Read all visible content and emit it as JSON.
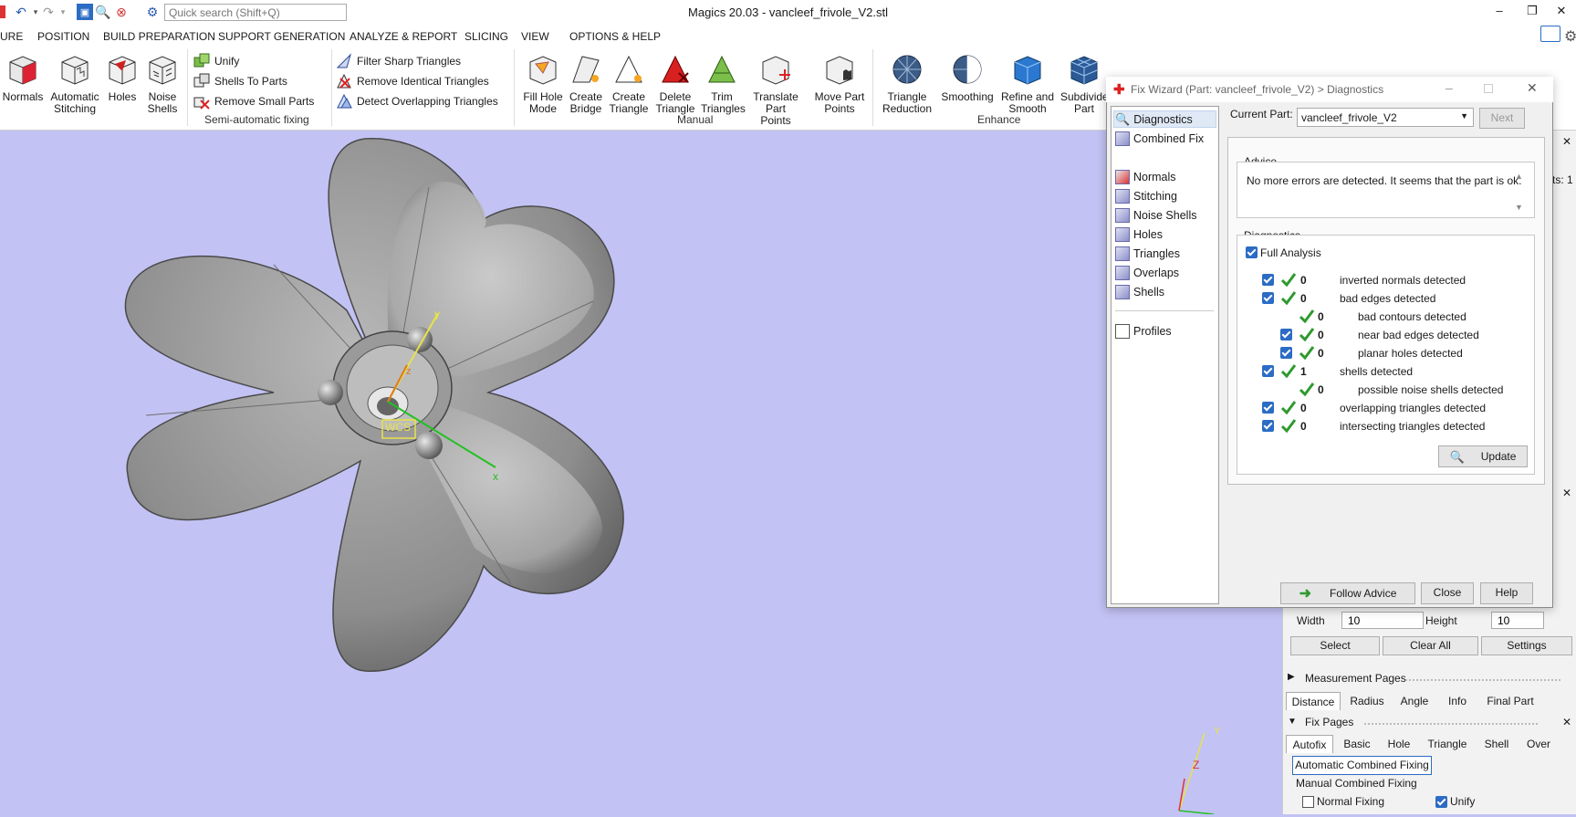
{
  "window": {
    "title": "Magics 20.03 - vancleef_frivole_V2.stl",
    "search_placeholder": "Quick search (Shift+Q)"
  },
  "menu": [
    "URE",
    "POSITION",
    "BUILD PREPARATION",
    "SUPPORT GENERATION",
    "ANALYZE & REPORT",
    "SLICING",
    "VIEW",
    "OPTIONS & HELP"
  ],
  "ribbon": {
    "normals": "Normals",
    "auto_stitch_1": "Automatic",
    "auto_stitch_2": "Stitching",
    "holes": "Holes",
    "noise_1": "Noise",
    "noise_2": "Shells",
    "unify": "Unify",
    "shells_to_parts": "Shells To Parts",
    "remove_small": "Remove Small Parts",
    "filter_sharp": "Filter Sharp Triangles",
    "remove_identical": "Remove Identical Triangles",
    "detect_overlap": "Detect Overlapping Triangles",
    "semi_auto_group": "Semi-automatic fixing",
    "fill_hole_1": "Fill Hole",
    "fill_hole_2": "Mode",
    "create_bridge_1": "Create",
    "create_bridge_2": "Bridge",
    "create_tri_1": "Create",
    "create_tri_2": "Triangle",
    "delete_tri_1": "Delete",
    "delete_tri_2": "Triangle",
    "trim_1": "Trim",
    "trim_2": "Triangles",
    "translate_1": "Translate",
    "translate_2": "Part Points",
    "move_1": "Move Part",
    "move_2": "Points",
    "manual_group": "Manual",
    "tri_red_1": "Triangle",
    "tri_red_2": "Reduction",
    "smoothing": "Smoothing",
    "refine_1": "Refine and",
    "refine_2": "Smooth",
    "subdiv_1": "Subdivide",
    "subdiv_2": "Part",
    "enhance_group": "Enhance"
  },
  "viewport": {
    "axis_x": "x",
    "axis_y": "y",
    "axis_z": "z",
    "wcs": "WCS",
    "mini_z": "Z",
    "mini_y": "Y"
  },
  "dialog": {
    "title": "Fix Wizard (Part: vancleef_frivole_V2) > Diagnostics",
    "nav": [
      "Diagnostics",
      "Combined Fix",
      "Normals",
      "Stitching",
      "Noise Shells",
      "Holes",
      "Triangles",
      "Overlaps",
      "Shells",
      "Profiles"
    ],
    "current_part_label": "Current Part:",
    "current_part_value": "vancleef_frivole_V2",
    "next": "Next",
    "advice_label": "Advice",
    "advice_text": "No more errors are detected. It seems that the part is ok.",
    "diagnostics_label": "Diagnostics",
    "full_analysis": "Full Analysis",
    "rows": [
      {
        "count": "0",
        "text": "inverted normals detected"
      },
      {
        "count": "0",
        "text": "bad edges detected"
      },
      {
        "count": "0",
        "text": "bad contours detected"
      },
      {
        "count": "0",
        "text": "near bad edges detected"
      },
      {
        "count": "0",
        "text": "planar holes detected"
      },
      {
        "count": "1",
        "text": "shells detected"
      },
      {
        "count": "0",
        "text": "possible noise shells detected"
      },
      {
        "count": "0",
        "text": "overlapping triangles detected"
      },
      {
        "count": "0",
        "text": "intersecting triangles detected"
      }
    ],
    "update": "Update",
    "follow_advice": "Follow Advice",
    "close": "Close",
    "help": "Help"
  },
  "right_panel": {
    "parts_snip": "rts: 1",
    "width_label": "Width",
    "width_value": "10",
    "height_label": "Height",
    "height_value": "10",
    "select": "Select",
    "clear_all": "Clear All",
    "settings": "Settings",
    "measurement_pages": "Measurement Pages",
    "measure_tabs": [
      "Distance",
      "Radius",
      "Angle",
      "Info",
      "Final Part"
    ],
    "fix_pages": "Fix Pages",
    "fix_tabs": [
      "Autofix",
      "Basic",
      "Hole",
      "Triangle",
      "Shell",
      "Over"
    ],
    "auto_combined": "Automatic Combined Fixing",
    "manual_combined": "Manual Combined Fixing",
    "normal_fixing": "Normal Fixing",
    "unify": "Unify"
  },
  "colors": {
    "viewport": "#c2c2f4",
    "accent": "#2b6cc4",
    "check_green": "#2e9a2e"
  }
}
